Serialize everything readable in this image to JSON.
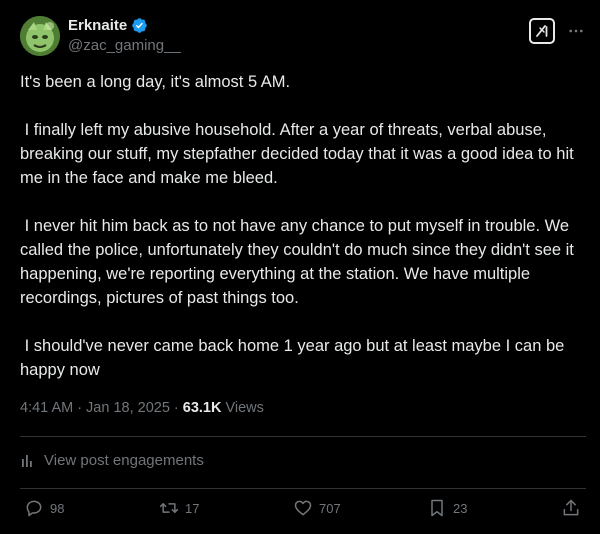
{
  "author": {
    "display_name": "Erknaite",
    "handle": "@zac_gaming__",
    "verified": true
  },
  "post": {
    "paragraphs": [
      "It's been a long day, it's almost 5 AM.",
      " I finally left my abusive household. After a year of threats, verbal abuse, breaking our stuff, my stepfather decided today that it was a good idea to hit me in the face and make me bleed.",
      " I never hit him back as to not have any chance to put myself in trouble. We called the police, unfortunately they couldn't do much since they didn't see it happening, we're reporting everything at the station. We have multiple recordings, pictures of past things too.",
      " I should've never came back home 1 year ago but at least maybe I can be happy now"
    ],
    "time": "4:41 AM",
    "date": "Jan 18, 2025",
    "separator_1": "·",
    "separator_2": "·",
    "views_count": "63.1K",
    "views_label": "Views"
  },
  "engagements_label": "View post engagements",
  "actions": {
    "replies": "98",
    "reposts": "17",
    "likes": "707",
    "bookmarks": "23"
  },
  "colors": {
    "background": "#000000",
    "text": "#e7e9ea",
    "muted": "#71767b",
    "verified": "#1d9bf0",
    "divider": "#2f3336"
  },
  "icons": [
    "verified-badge-icon",
    "grok-icon",
    "more-icon",
    "analytics-icon",
    "reply-icon",
    "repost-icon",
    "like-icon",
    "bookmark-icon",
    "share-icon"
  ]
}
